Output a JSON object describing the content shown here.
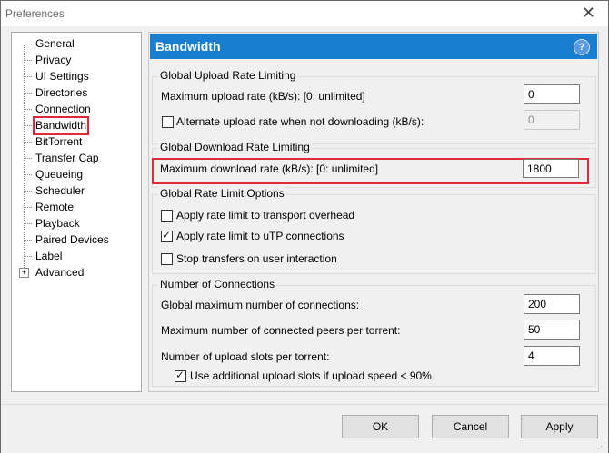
{
  "window": {
    "title": "Preferences",
    "close_icon": "✕"
  },
  "sidebar": {
    "items": [
      {
        "label": "General"
      },
      {
        "label": "Privacy"
      },
      {
        "label": "UI Settings"
      },
      {
        "label": "Directories"
      },
      {
        "label": "Connection"
      },
      {
        "label": "Bandwidth",
        "selected": true
      },
      {
        "label": "BitTorrent"
      },
      {
        "label": "Transfer Cap"
      },
      {
        "label": "Queueing"
      },
      {
        "label": "Scheduler"
      },
      {
        "label": "Remote"
      },
      {
        "label": "Playback"
      },
      {
        "label": "Paired Devices"
      },
      {
        "label": "Label"
      },
      {
        "label": "Advanced",
        "expandable": true
      }
    ],
    "expand_icon": "+"
  },
  "panel": {
    "title": "Bandwidth",
    "help_icon": "?",
    "upload_group": {
      "title": "Global Upload Rate Limiting",
      "max_upload_label": "Maximum upload rate (kB/s): [0: unlimited]",
      "max_upload_value": "0",
      "alt_upload_label": "Alternate upload rate when not downloading (kB/s):",
      "alt_upload_checked": false,
      "alt_upload_value": "0"
    },
    "download_group": {
      "title": "Global Download Rate Limiting",
      "max_download_label": "Maximum download rate (kB/s): [0: unlimited]",
      "max_download_value": "1800"
    },
    "options_group": {
      "title": "Global Rate Limit Options",
      "opt1_label": "Apply rate limit to transport overhead",
      "opt1_checked": false,
      "opt2_label": "Apply rate limit to uTP connections",
      "opt2_checked": true,
      "opt3_label": "Stop transfers on user interaction",
      "opt3_checked": false
    },
    "connections_group": {
      "title": "Number of Connections",
      "global_max_label": "Global maximum number of connections:",
      "global_max_value": "200",
      "peers_label": "Maximum number of connected peers per torrent:",
      "peers_value": "50",
      "slots_label": "Number of upload slots per torrent:",
      "slots_value": "4",
      "additional_label": "Use additional upload slots if upload speed < 90%",
      "additional_checked": true
    }
  },
  "footer": {
    "ok_label": "OK",
    "cancel_label": "Cancel",
    "apply_label": "Apply"
  },
  "colors": {
    "header": "#1a7ed0",
    "highlight": "#e0293a"
  }
}
